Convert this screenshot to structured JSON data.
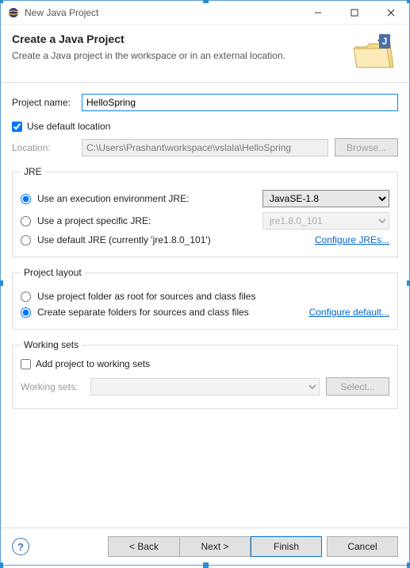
{
  "window": {
    "title": "New Java Project"
  },
  "header": {
    "title": "Create a Java Project",
    "subtitle": "Create a Java project in the workspace or in an external location."
  },
  "project_name": {
    "label": "Project name:",
    "value": "HelloSpring"
  },
  "default_location": {
    "label": "Use default location",
    "checked": true
  },
  "location": {
    "label": "Location:",
    "value": "C:\\Users\\Prashant\\workspace\\vslala\\HelloSpring",
    "browse": "Browse..."
  },
  "jre": {
    "legend": "JRE",
    "exec_env": {
      "label": "Use an execution environment JRE:",
      "value": "JavaSE-1.8"
    },
    "project_specific": {
      "label": "Use a project specific JRE:",
      "value": "jre1.8.0_101"
    },
    "default_jre": {
      "label": "Use default JRE (currently 'jre1.8.0_101')"
    },
    "configure": "Configure JREs..."
  },
  "layout": {
    "legend": "Project layout",
    "root": "Use project folder as root for sources and class files",
    "separate": "Create separate folders for sources and class files",
    "configure": "Configure default..."
  },
  "working_sets": {
    "legend": "Working sets",
    "add": {
      "label": "Add project to working sets",
      "checked": false
    },
    "label": "Working sets:",
    "select": "Select..."
  },
  "footer": {
    "back": "< Back",
    "next": "Next >",
    "finish": "Finish",
    "cancel": "Cancel"
  }
}
